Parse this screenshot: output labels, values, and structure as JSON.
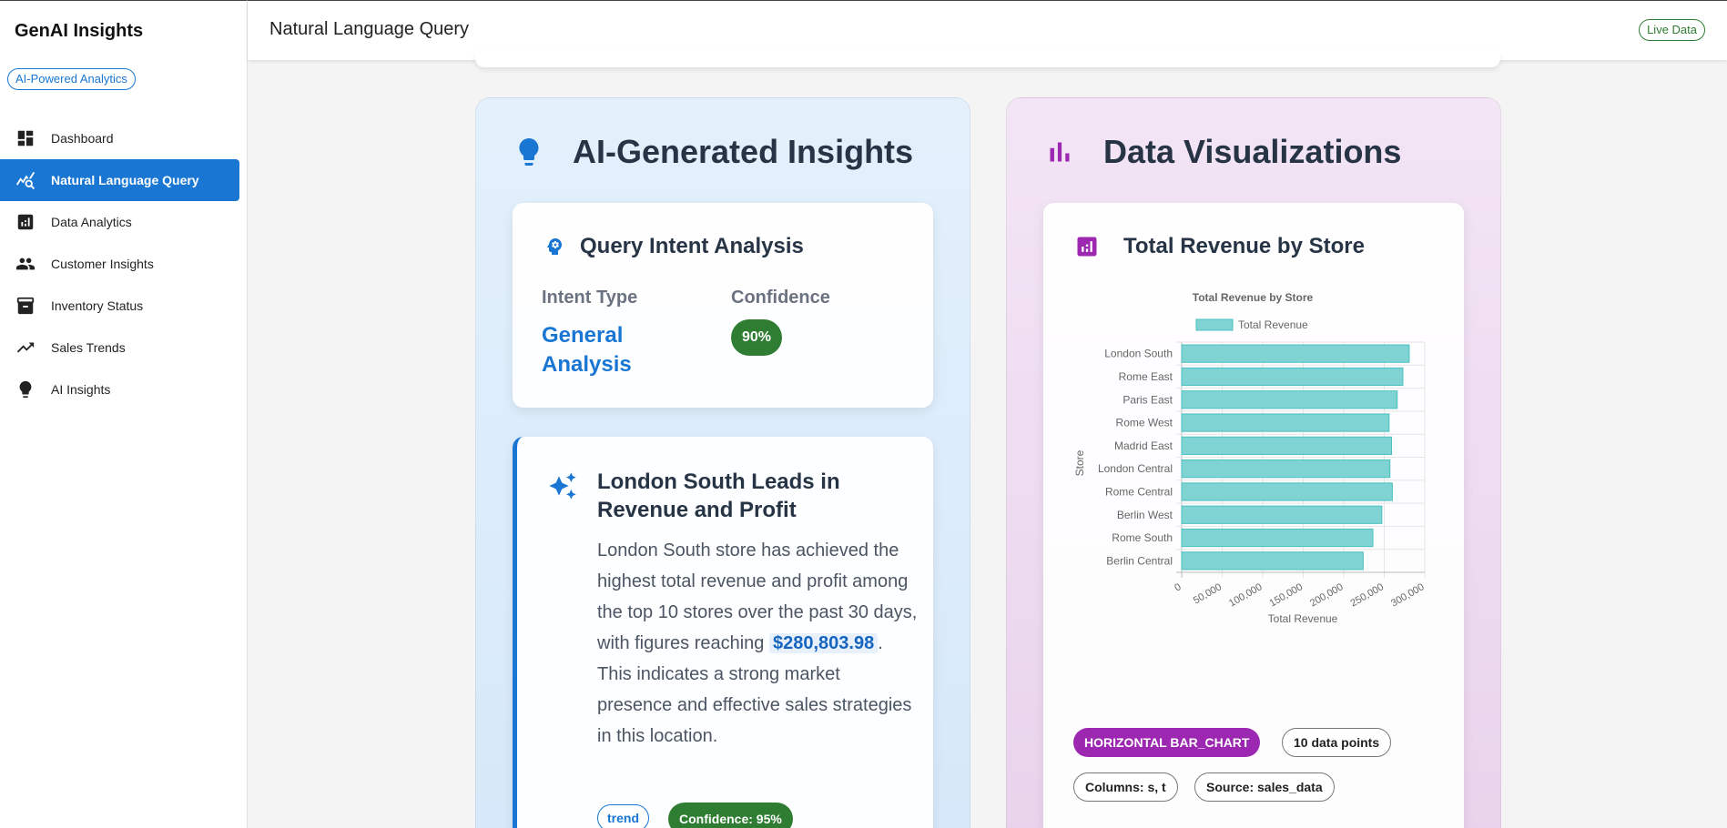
{
  "app": {
    "brand": "GenAI Insights",
    "badge": "AI-Powered Analytics"
  },
  "nav": [
    {
      "label": "Dashboard",
      "icon": "dashboard-icon",
      "active": false
    },
    {
      "label": "Natural Language Query",
      "icon": "query-stats-icon",
      "active": true
    },
    {
      "label": "Data Analytics",
      "icon": "analytics-icon",
      "active": false
    },
    {
      "label": "Customer Insights",
      "icon": "people-icon",
      "active": false
    },
    {
      "label": "Inventory Status",
      "icon": "inventory-icon",
      "active": false
    },
    {
      "label": "Sales Trends",
      "icon": "trending-up-icon",
      "active": false
    },
    {
      "label": "AI Insights",
      "icon": "lightbulb-icon",
      "active": false
    }
  ],
  "header": {
    "title": "Natural Language Query",
    "live_label": "Live Data"
  },
  "insights_panel": {
    "title": "AI-Generated Insights",
    "intent": {
      "title": "Query Intent Analysis",
      "intent_type_label": "Intent Type",
      "intent_type_value": "General Analysis",
      "confidence_label": "Confidence",
      "confidence_value": "90%"
    },
    "insight": {
      "title": "London South Leads in Revenue and Profit",
      "body_before": "London South store has achieved the highest total revenue and profit among the top 10 stores over the past 30 days, with figures reaching ",
      "highlight": "$280,803.98",
      "body_after": ". This indicates a strong market presence and effective sales strategies in this location.",
      "tag": "trend",
      "confidence": "Confidence: 95%"
    }
  },
  "viz_panel": {
    "title": "Data Visualizations",
    "card_title": "Total Revenue by Store",
    "chips": {
      "type": "HORIZONTAL BAR_CHART",
      "points": "10 data points",
      "columns": "Columns: s, t",
      "source": "Source: sales_data"
    }
  },
  "chart_data": {
    "type": "bar",
    "orientation": "horizontal",
    "title": "Total Revenue by Store",
    "xlabel": "Total Revenue",
    "ylabel": "Store",
    "xlim": [
      0,
      300000
    ],
    "xticks": [
      "0",
      "50,000",
      "100,000",
      "150,000",
      "200,000",
      "250,000",
      "300,000"
    ],
    "categories": [
      "London South",
      "Rome East",
      "Paris East",
      "Rome West",
      "Madrid East",
      "London Central",
      "Rome Central",
      "Berlin West",
      "Rome South",
      "Berlin Central"
    ],
    "series": [
      {
        "name": "Total Revenue",
        "values": [
          280804,
          273000,
          266000,
          256000,
          259000,
          257000,
          260000,
          247000,
          236000,
          224000
        ]
      }
    ],
    "colors": {
      "bar_fill": "#80d3d3",
      "bar_stroke": "#4bc0c0"
    },
    "grid": true,
    "legend": "top"
  }
}
